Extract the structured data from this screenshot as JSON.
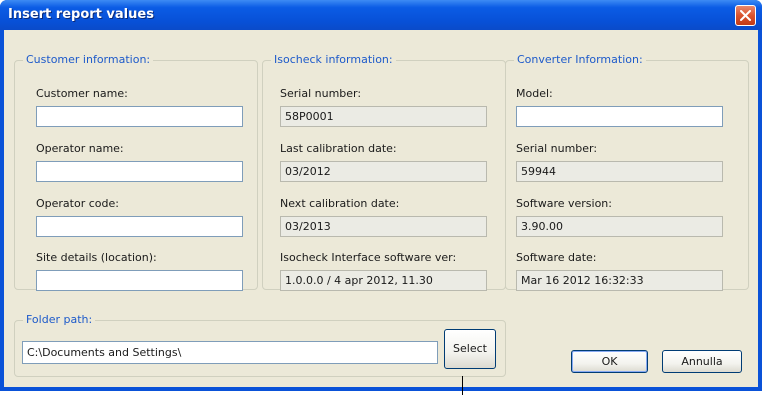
{
  "window": {
    "title": "Insert report values"
  },
  "customer": {
    "legend": "Customer information:",
    "customer_name_label": "Customer name:",
    "customer_name_value": "",
    "operator_name_label": "Operator name:",
    "operator_name_value": "",
    "operator_code_label": "Operator code:",
    "operator_code_value": "",
    "site_details_label": "Site details (location):",
    "site_details_value": ""
  },
  "isocheck": {
    "legend": "Isocheck information:",
    "serial_label": "Serial number:",
    "serial_value": "58P0001",
    "last_cal_label": "Last calibration date:",
    "last_cal_value": "03/2012",
    "next_cal_label": "Next calibration date:",
    "next_cal_value": "03/2013",
    "iface_sw_label": "Isocheck Interface software ver:",
    "iface_sw_value": "1.0.0.0 / 4 apr 2012, 11.30"
  },
  "converter": {
    "legend": "Converter Information:",
    "model_label": "Model:",
    "model_value": "",
    "serial_label": "Serial number:",
    "serial_value": "59944",
    "sw_version_label": "Software version:",
    "sw_version_value": "3.90.00",
    "sw_date_label": "Software date:",
    "sw_date_value": "Mar 16 2012 16:32:33"
  },
  "folder": {
    "legend": "Folder path:",
    "path_value": "C:\\Documents and Settings\\",
    "select_label": "Select"
  },
  "buttons": {
    "ok_label": "OK",
    "cancel_label": "Annulla"
  },
  "icons": {
    "close": "close-icon"
  },
  "colors": {
    "title_bar": "#0a52d8",
    "legend_text": "#1d5aca",
    "dialog_bg": "#ece9d8",
    "close_button": "#d9532e"
  }
}
